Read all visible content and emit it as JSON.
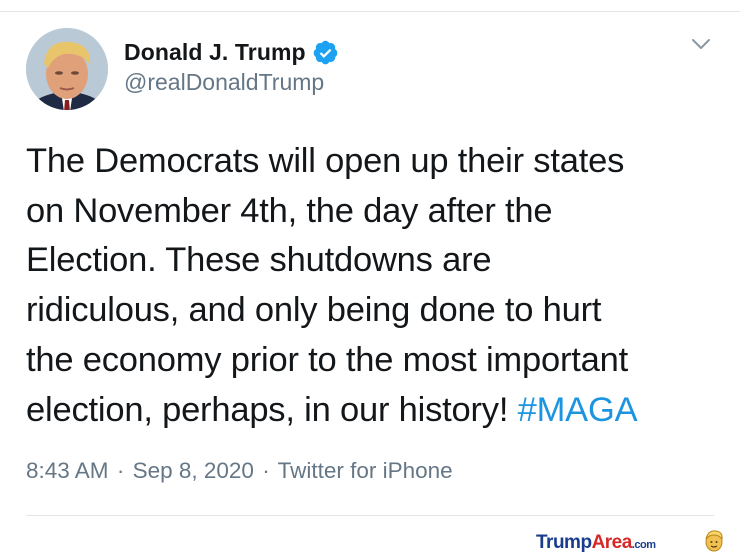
{
  "tweet": {
    "display_name": "Donald J. Trump",
    "handle": "@realDonaldTrump",
    "verified_icon": "verified-badge-icon",
    "menu_icon": "chevron-down-icon",
    "text_lines": [
      "The Democrats will open up their states",
      "on November 4th, the day after the",
      "Election. These shutdowns are",
      "ridiculous, and only being done to hurt",
      "the economy prior to the most important",
      "election, perhaps, in our history! "
    ],
    "hashtag": "#MAGA",
    "time": "8:43 AM",
    "date": "Sep 8, 2020",
    "source": "Twitter for iPhone",
    "sep": "·"
  },
  "watermark": {
    "part1": "Trump",
    "part2": "Area",
    "suffix": ".com"
  },
  "colors": {
    "text": "#14171a",
    "secondary": "#657786",
    "link": "#1b95e0",
    "verified": "#1da1f2"
  }
}
